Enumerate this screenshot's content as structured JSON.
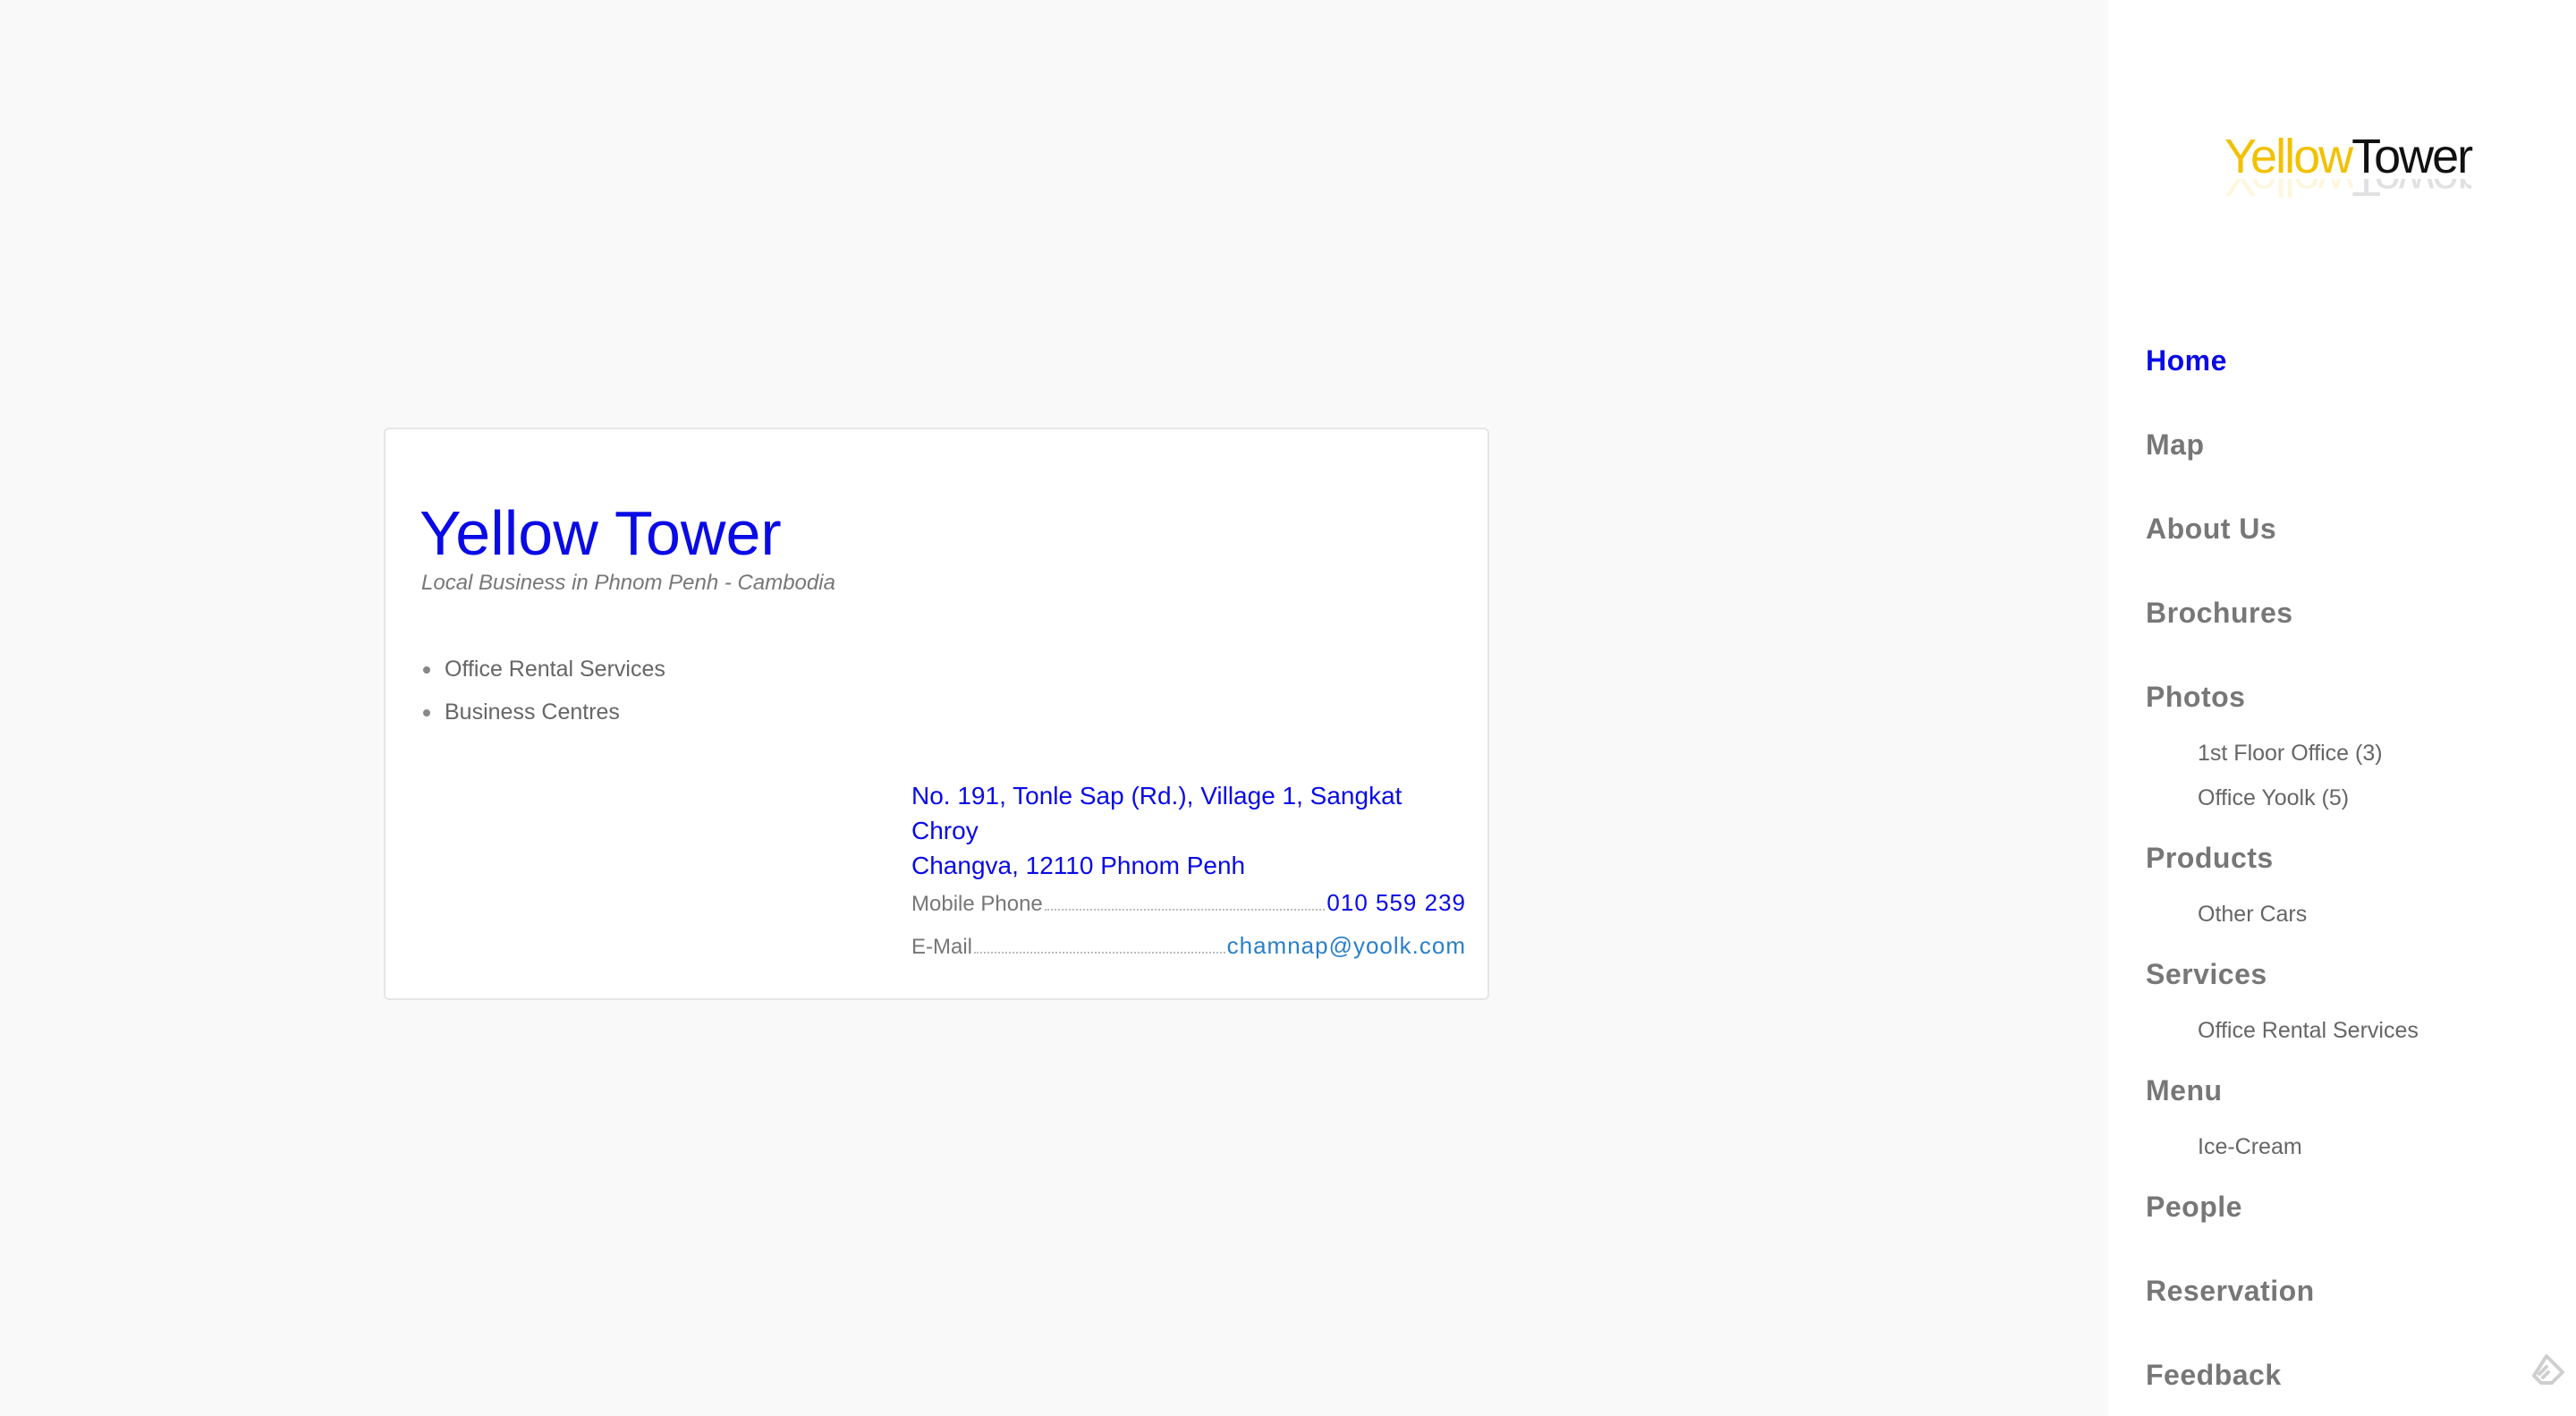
{
  "business": {
    "title": "Yellow Tower",
    "subtitle": "Local Business in Phnom Penh - Cambodia",
    "categories": [
      "Office Rental Services",
      "Business Centres"
    ],
    "address_line1": "No. 191, Tonle Sap (Rd.), Village 1, Sangkat Chroy",
    "address_line2": "Changva, 12110 Phnom Penh",
    "phone_label": "Mobile Phone",
    "phone_value": "010 559 239",
    "email_label": "E-Mail",
    "email_value": "chamnap@yoolk.com"
  },
  "logo": {
    "part1": "Yellow",
    "part2": "Tower",
    "color1": "#f2c100",
    "color2": "#111111"
  },
  "sidebar": {
    "home": "Home",
    "map": "Map",
    "about": "About Us",
    "brochures": "Brochures",
    "photos": "Photos",
    "photos_sub1": "1st Floor Office (3)",
    "photos_sub2": "Office Yoolk (5)",
    "products": "Products",
    "products_sub1": "Other Cars",
    "services": "Services",
    "services_sub1": "Office Rental Services",
    "menu": "Menu",
    "menu_sub1": "Ice-Cream",
    "people": "People",
    "reservation": "Reservation",
    "feedback": "Feedback"
  },
  "colors": {
    "accent": "#0a0ae6",
    "link": "#2a7fc8",
    "muted": "#777777",
    "page_bg": "#f9f9f9"
  },
  "icons": {
    "corner": "feedly-icon"
  }
}
